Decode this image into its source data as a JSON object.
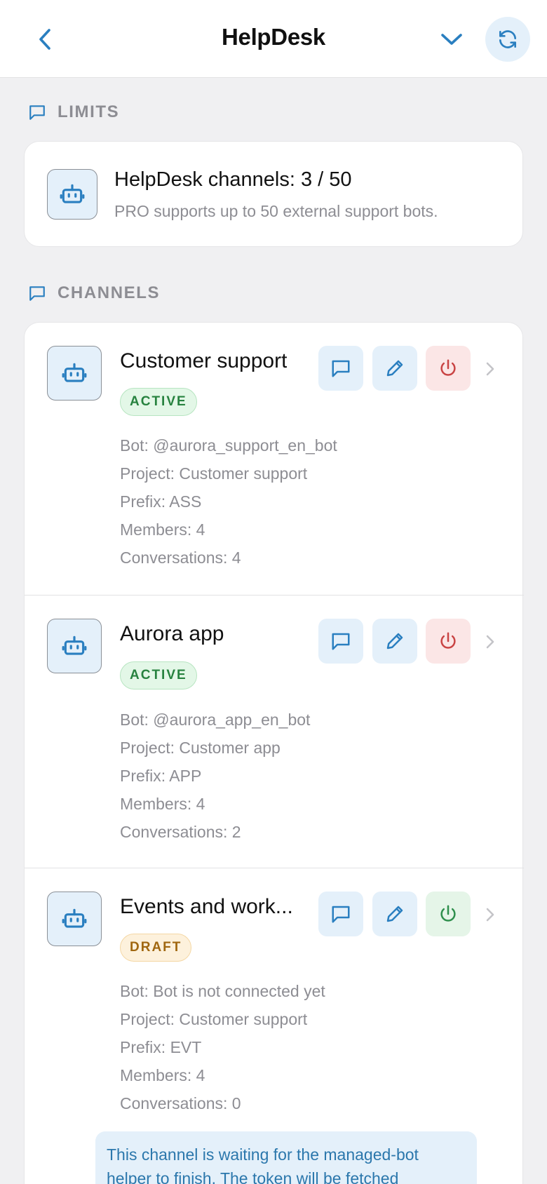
{
  "header": {
    "title": "HelpDesk",
    "back_icon": "chevron-left-icon",
    "menu_icon": "chevron-down-icon",
    "refresh_icon": "refresh-icon"
  },
  "limits": {
    "section_label": "LIMITS",
    "title": "HelpDesk channels: 3 / 50",
    "subtitle": "PRO supports up to 50 external support bots."
  },
  "channels_section": {
    "section_label": "CHANNELS",
    "items": [
      {
        "name": "Customer support",
        "status": "ACTIVE",
        "bot": "Bot: @aurora_support_en_bot",
        "project": "Project: Customer support",
        "prefix": "Prefix: ASS",
        "members": "Members: 4",
        "conversations": "Conversations: 4"
      },
      {
        "name": "Aurora app",
        "status": "ACTIVE",
        "bot": "Bot: @aurora_app_en_bot",
        "project": "Project: Customer app",
        "prefix": "Prefix: APP",
        "members": "Members: 4",
        "conversations": "Conversations: 2"
      },
      {
        "name": "Events and work...",
        "status": "DRAFT",
        "bot": "Bot: Bot is not connected yet",
        "project": "Project: Customer support",
        "prefix": "Prefix: EVT",
        "members": "Members: 4",
        "conversations": "Conversations: 0"
      }
    ],
    "notice": "This channel is waiting for the managed-bot helper to finish. The token will be fetched"
  },
  "colors": {
    "accent": "#2a7fc0",
    "active": "#27823f",
    "draft": "#a06710",
    "power_off": "#c94444",
    "power_on": "#2f8f4d"
  }
}
